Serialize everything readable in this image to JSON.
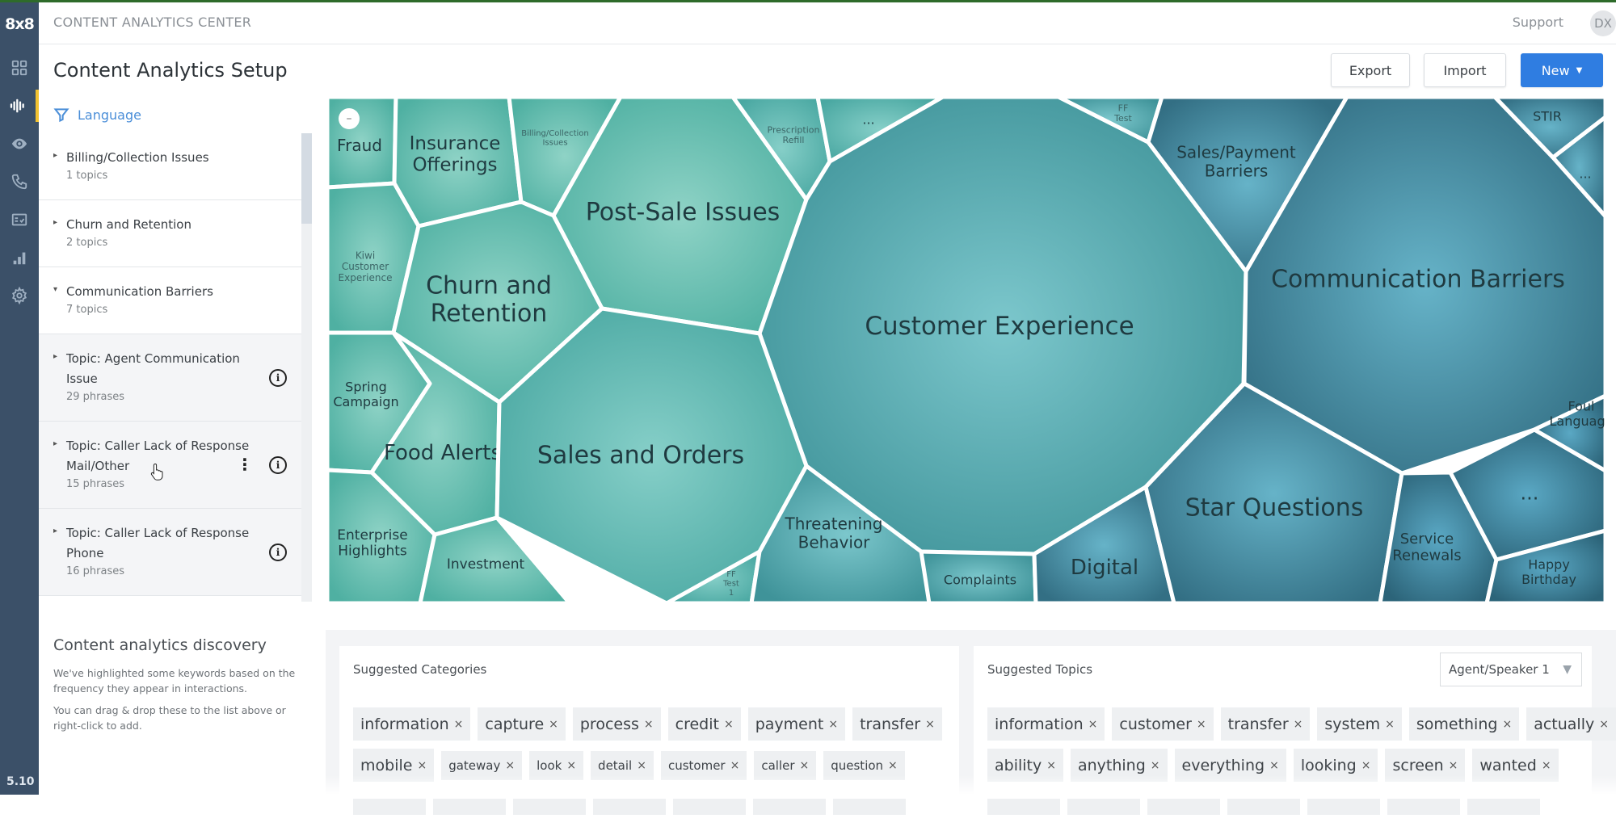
{
  "app": {
    "logo": "8x8",
    "title": "CONTENT ANALYTICS CENTER",
    "support_label": "Support",
    "avatar_initials": "DX",
    "version": "5.10",
    "accent_color": "#2f7de1",
    "nav_items": [
      {
        "icon": "dashboard-icon"
      },
      {
        "icon": "speech-analytics-icon",
        "active": true
      },
      {
        "icon": "eye-icon"
      },
      {
        "icon": "phone-icon"
      },
      {
        "icon": "scorecard-icon"
      },
      {
        "icon": "bar-chart-icon"
      },
      {
        "icon": "gear-icon"
      }
    ]
  },
  "page": {
    "title": "Content Analytics Setup",
    "buttons": {
      "export": "Export",
      "import": "Import",
      "new": "New"
    }
  },
  "filter": {
    "label": "Language",
    "icon": "filter-icon"
  },
  "list": {
    "items": [
      {
        "type": "category",
        "title": "Billing/Collection Issues",
        "sub": "1 topics"
      },
      {
        "type": "category",
        "title": "Churn and Retention",
        "sub": "2 topics"
      },
      {
        "type": "category",
        "title": "Communication Barriers",
        "sub": "7 topics",
        "expanded": true
      },
      {
        "type": "topic",
        "title": "Topic:  Agent Communication Issue",
        "sub": "29 phrases"
      },
      {
        "type": "topic",
        "title": "Topic:  Caller Lack of Response Mail/Other",
        "sub": "15 phrases",
        "hovered": true
      },
      {
        "type": "topic",
        "title": "Topic:  Caller Lack of Response Phone",
        "sub": "16 phrases"
      }
    ]
  },
  "treemap": {
    "collapse_label": "–",
    "cells": [
      {
        "label": "Fraud"
      },
      {
        "label": "Insurance Offerings"
      },
      {
        "label": "Billing/Collection Issues"
      },
      {
        "label": "Post-Sale Issues"
      },
      {
        "label": "Prescription Refill"
      },
      {
        "label": "..."
      },
      {
        "label": "Customer Experience"
      },
      {
        "label": "FF Test"
      },
      {
        "label": "Sales/Payment Barriers"
      },
      {
        "label": "Communication Barriers"
      },
      {
        "label": "STIR"
      },
      {
        "label": "..."
      },
      {
        "label": "Kiwi Customer Experience"
      },
      {
        "label": "Churn and Retention"
      },
      {
        "label": "Spring Campaign"
      },
      {
        "label": "Food Alerts"
      },
      {
        "label": "Sales and Orders"
      },
      {
        "label": "Enterprise Highlights"
      },
      {
        "label": "Investment"
      },
      {
        "label": "FF Test 1"
      },
      {
        "label": "Threatening Behavior"
      },
      {
        "label": "Complaints"
      },
      {
        "label": "Digital"
      },
      {
        "label": "Star Questions"
      },
      {
        "label": "Service Renewals"
      },
      {
        "label": "..."
      },
      {
        "label": "Foul Language"
      },
      {
        "label": "Happy Birthday"
      }
    ]
  },
  "discovery": {
    "title": "Content analytics discovery",
    "p1": "We've highlighted some keywords based on the frequency they appear in interactions.",
    "p2": "You can drag & drop these to the list above or right-click to add."
  },
  "suggested_categories": {
    "title": "Suggested Categories",
    "rows": [
      [
        "information",
        "capture",
        "process",
        "credit",
        "payment",
        "transfer"
      ],
      [
        "mobile",
        "gateway",
        "look",
        "detail",
        "customer",
        "caller",
        "question"
      ]
    ]
  },
  "suggested_topics": {
    "title": "Suggested Topics",
    "speaker_select": "Agent/Speaker 1",
    "rows": [
      [
        "information",
        "customer",
        "transfer",
        "system",
        "something",
        "actually"
      ],
      [
        "ability",
        "anything",
        "everything",
        "looking",
        "screen",
        "wanted"
      ]
    ]
  }
}
